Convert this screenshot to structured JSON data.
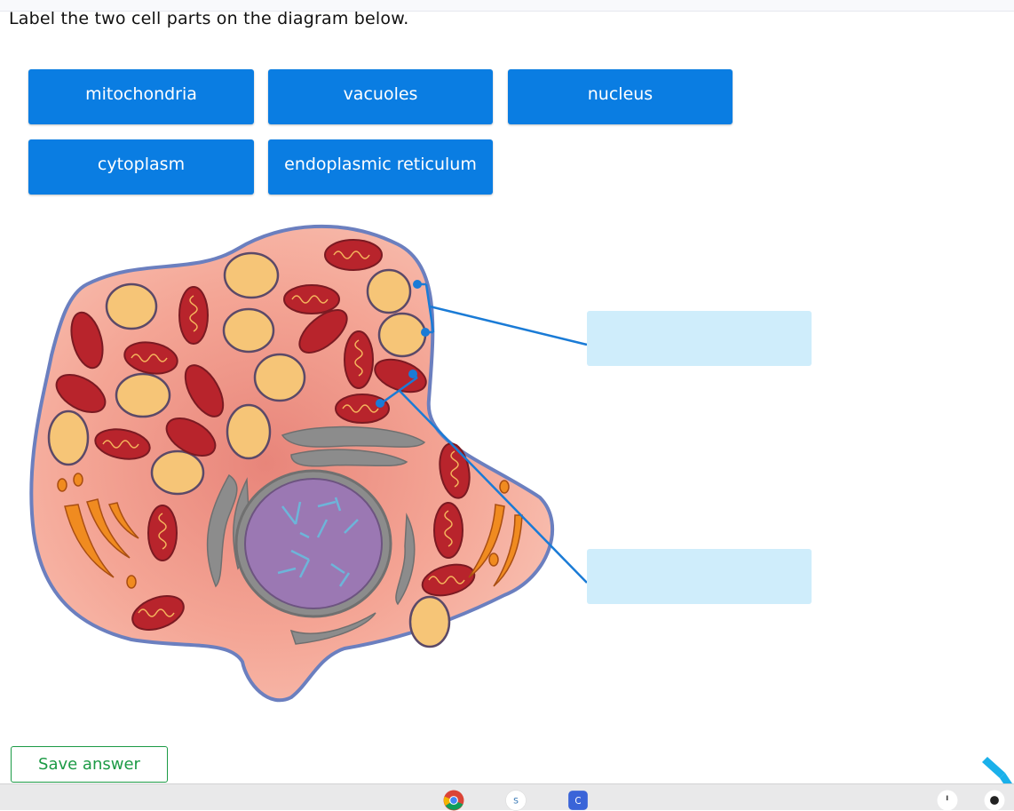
{
  "prompt": "Label the two cell parts on the diagram below.",
  "answer_chips": [
    {
      "label": "mitochondria"
    },
    {
      "label": "vacuoles"
    },
    {
      "label": "nucleus"
    },
    {
      "label": "cytoplasm"
    },
    {
      "label": "endoplasmic reticulum"
    }
  ],
  "drop_zones": [
    {
      "value": ""
    },
    {
      "value": ""
    }
  ],
  "save_label": "Save answer",
  "colors": {
    "chip": "#0a7de2",
    "dropzone": "#cfedfb",
    "leader_line": "#1a7bd6",
    "save": "#1c9a45",
    "cell_fill": "#f7b7a5",
    "cell_border": "#6b7fbf",
    "vacuole": "#f6c577",
    "mitochondria": "#b8242c",
    "nucleus": "#9b78b3",
    "golgi": "#8c8c8c",
    "er": "#f08b20"
  },
  "taskbar": {
    "icons": [
      "chrome-icon",
      "s-app-icon",
      "c-app-icon",
      "notification-icon",
      "profile-icon"
    ]
  }
}
